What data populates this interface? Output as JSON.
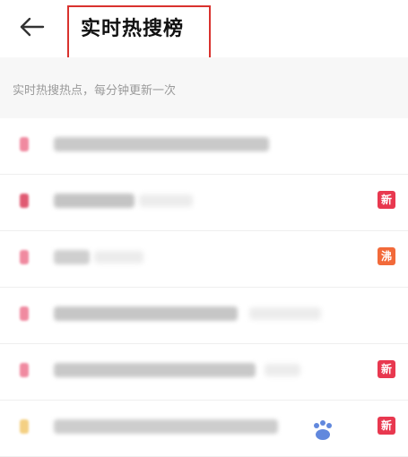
{
  "header": {
    "title": "实时热搜榜",
    "back_icon": "arrow-left-icon"
  },
  "subheader": {
    "text": "实时热搜热点，每分钟更新一次"
  },
  "colors": {
    "highlight_box": "#d9322e",
    "badge_new": "#e8384f",
    "badge_hot": "#f26a3a",
    "rank_top": "#f08aa0",
    "rank_yellow": "#f4d083"
  },
  "list": {
    "items": [
      {
        "badge": ""
      },
      {
        "badge": "新"
      },
      {
        "badge": "沸"
      },
      {
        "badge": ""
      },
      {
        "badge": "新"
      },
      {
        "badge": "新"
      }
    ]
  }
}
